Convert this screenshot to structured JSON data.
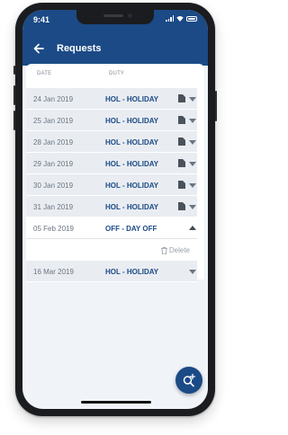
{
  "status": {
    "time": "9:41"
  },
  "header": {
    "title": "Requests"
  },
  "columns": {
    "date": "DATE",
    "duty": "DUTY"
  },
  "rows": [
    {
      "date": "24 Jan 2019",
      "duty": "HOL - HOLIDAY"
    },
    {
      "date": "25 Jan 2019",
      "duty": "HOL - HOLIDAY"
    },
    {
      "date": "28 Jan 2019",
      "duty": "HOL - HOLIDAY"
    },
    {
      "date": "29 Jan 2019",
      "duty": "HOL - HOLIDAY"
    },
    {
      "date": "30 Jan 2019",
      "duty": "HOL - HOLIDAY"
    },
    {
      "date": "31 Jan 2019",
      "duty": "HOL - HOLIDAY"
    }
  ],
  "expanded": {
    "date": "05 Feb 2019",
    "duty": "OFF - DAY OFF",
    "delete_label": "Delete"
  },
  "last": {
    "date": "16 Mar 2019",
    "duty": "HOL - HOLIDAY"
  },
  "colors": {
    "primary": "#1b4a86",
    "row_bg": "#e9edf2",
    "screen_bg": "#f0f4f8"
  },
  "icons": {
    "back": "arrow-left-icon",
    "doc": "document-icon",
    "expand": "chevron-down-icon",
    "collapse": "chevron-up-icon",
    "delete": "trash-icon",
    "fab": "search-add-icon"
  }
}
